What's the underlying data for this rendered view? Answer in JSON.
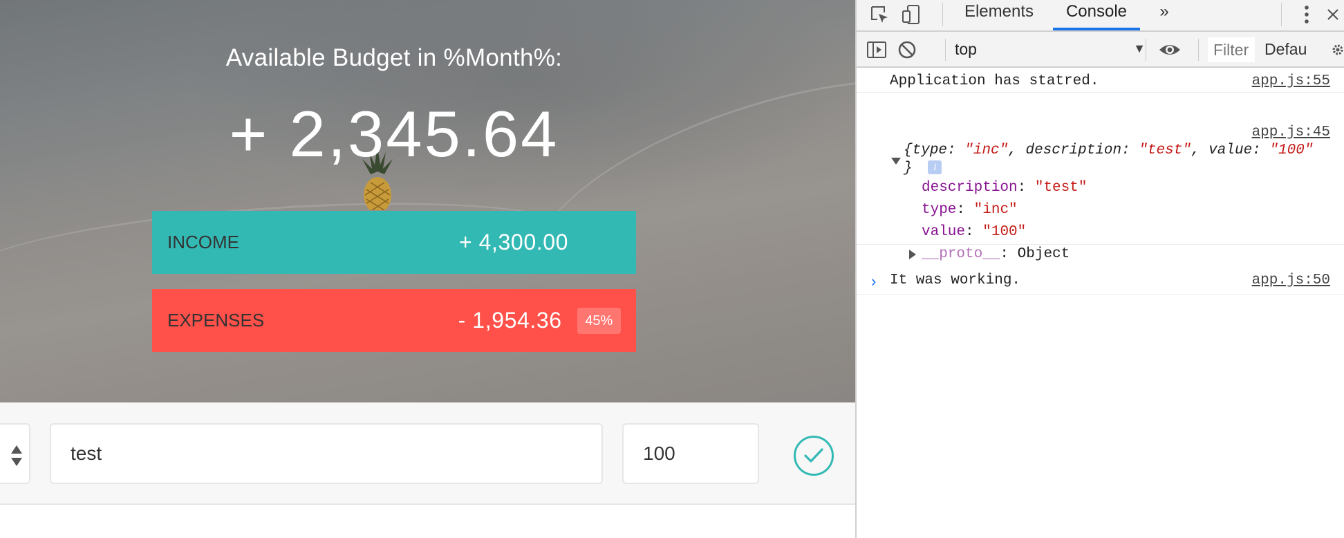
{
  "budget": {
    "title": "Available Budget in %Month%:",
    "value": "+ 2,345.64",
    "income": {
      "label": "INCOME",
      "value": "+ 4,300.00"
    },
    "expenses": {
      "label": "EXPENSES",
      "value": "- 1,954.36",
      "percentage": "45%"
    }
  },
  "add_form": {
    "description_value": "test",
    "amount_value": "100"
  },
  "devtools": {
    "tabs": [
      "Elements",
      "Console"
    ],
    "active_tab": "Console",
    "more_tabs_glyph": "»",
    "context": "top",
    "filter_placeholder": "Filter",
    "levels": "Defau",
    "accent": "#1a73e8"
  },
  "console": {
    "msg1": {
      "text": "Application has statred.",
      "source": "app.js:55"
    },
    "msg2": {
      "source": "app.js:45",
      "summary_open": "{",
      "k_type": "type",
      "v_type": "\"inc\"",
      "k_desc": "description",
      "v_desc": "\"test\"",
      "k_value": "value",
      "v_value": "\"100\"",
      "summary_close": "}",
      "info": "i",
      "props": [
        {
          "key": "description",
          "value": "\"test\""
        },
        {
          "key": "type",
          "value": "\"inc\""
        },
        {
          "key": "value",
          "value": "\"100\""
        }
      ],
      "proto_key": "__proto__",
      "proto_value": "Object"
    },
    "msg3": {
      "text": "It was working.",
      "source": "app.js:50"
    },
    "prompt": "›"
  },
  "colors": {
    "income": "#33b9b4",
    "expenses": "#ff5049"
  },
  "icons": [
    "pineapple-icon",
    "sort-arrows-icon",
    "checkmark-icon",
    "inspect-icon",
    "device-icon",
    "kebab-icon",
    "close-icon",
    "sidebar-icon",
    "clear-icon",
    "eye-icon",
    "gear-icon"
  ]
}
